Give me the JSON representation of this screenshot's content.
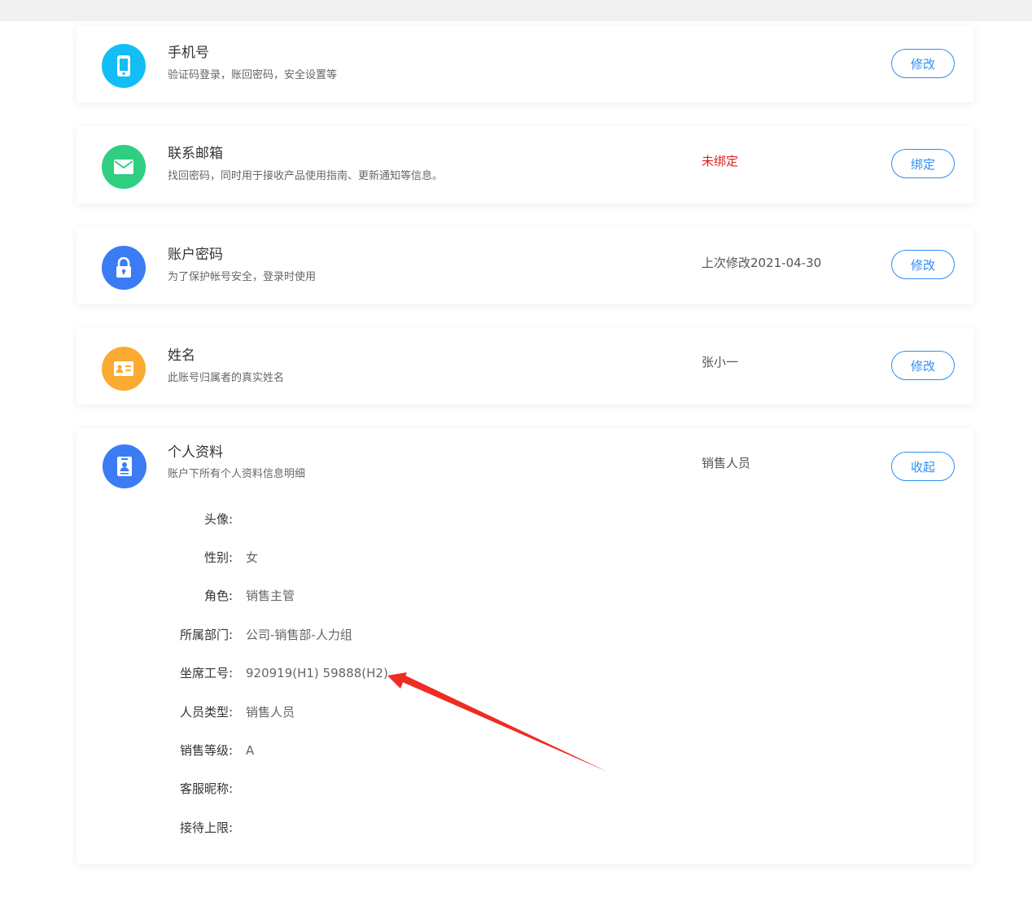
{
  "colors": {
    "phone_icon": "#13bdf5",
    "email_icon": "#2fce80",
    "password_icon": "#3b7cf5",
    "name_icon": "#fbab32",
    "profile_icon": "#3b7cf5",
    "button": "#2f8df4",
    "unbound": "#e0201f",
    "arrow": "#ee2c24"
  },
  "cards": {
    "phone": {
      "icon": "phone-icon",
      "title": "手机号",
      "desc": "验证码登录，账回密码，安全设置等",
      "status": "",
      "button": "修改"
    },
    "email": {
      "icon": "mail-icon",
      "title": "联系邮箱",
      "desc": "找回密码，同时用于接收产品使用指南、更新通知等信息。",
      "status": "未绑定",
      "button": "绑定"
    },
    "password": {
      "icon": "lock-icon",
      "title": "账户密码",
      "desc": "为了保护帐号安全，登录时使用",
      "status": "上次修改2021-04-30",
      "button": "修改"
    },
    "name": {
      "icon": "id-card-icon",
      "title": "姓名",
      "desc": "此账号归属者的真实姓名",
      "status": "张小一",
      "button": "修改"
    },
    "profile": {
      "icon": "badge-icon",
      "title": "个人资料",
      "desc": "账户下所有个人资料信息明细",
      "status": "销售人员",
      "button": "收起"
    }
  },
  "profile_details": [
    {
      "label": "头像:",
      "value": ""
    },
    {
      "label": "性别:",
      "value": "女"
    },
    {
      "label": "角色:",
      "value": "销售主管"
    },
    {
      "label": "所属部门:",
      "value": "公司-销售部-人力组"
    },
    {
      "label": "坐席工号:",
      "value": "920919(H1) 59888(H2)"
    },
    {
      "label": "人员类型:",
      "value": "销售人员"
    },
    {
      "label": "销售等级:",
      "value": "A"
    },
    {
      "label": "客服昵称:",
      "value": ""
    },
    {
      "label": "接待上限:",
      "value": ""
    }
  ]
}
